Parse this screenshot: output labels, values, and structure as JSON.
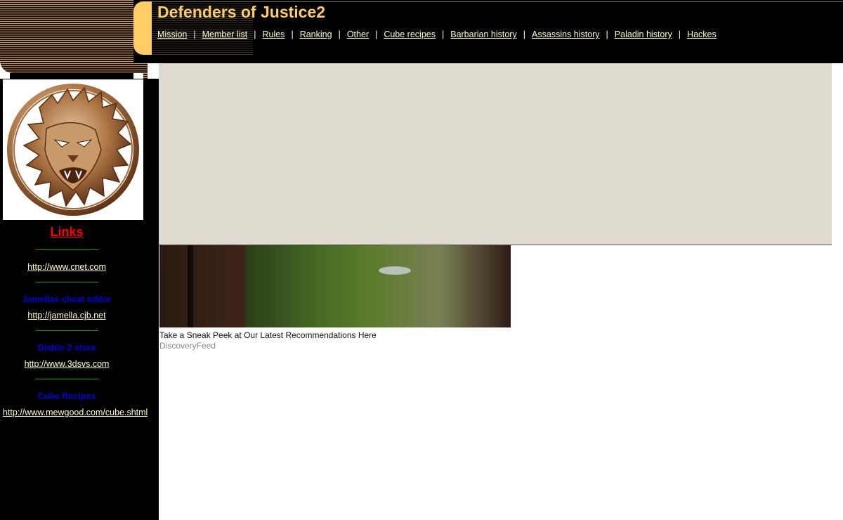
{
  "header": {
    "title": "Defenders of Justice2",
    "nav": [
      {
        "label": "Mission"
      },
      {
        "label": "Member list"
      },
      {
        "label": "Rules"
      },
      {
        "label": "Ranking"
      },
      {
        "label": "Other"
      },
      {
        "label": "Cube recipes"
      },
      {
        "label": "Barbarian history"
      },
      {
        "label": "Assassins history"
      },
      {
        "label": "Paladin history"
      },
      {
        "label": "Hackes"
      }
    ],
    "separator": "|"
  },
  "sidebar": {
    "logo_icon": "lion-head-emblem-icon",
    "links_title": "Links",
    "divider": "---------------------------------------------",
    "entries": [
      {
        "heading": "",
        "url": "http://www.cnet.com"
      },
      {
        "heading": "Jamellas cheat editor",
        "url": "http://jamella.cjb.net"
      },
      {
        "heading": "Diablo 2 store",
        "url": "http://www.3dsvs.com"
      },
      {
        "heading": "Cube Recipes",
        "url": "http://www.mewgood.com/cube.shtml"
      }
    ]
  },
  "promo": {
    "caption": "Take a Sneak Peek at Our Latest Recommendations Here",
    "source": "DiscoveryFeed",
    "image_icon": "mountain-valley-photo"
  },
  "colors": {
    "title": "#ffcc66",
    "nav_link": "#ffffcc",
    "links_title": "#ff0000",
    "divider": "#33cc33",
    "side_heading": "#0000dd",
    "ad_background": "#dfdbd0"
  }
}
